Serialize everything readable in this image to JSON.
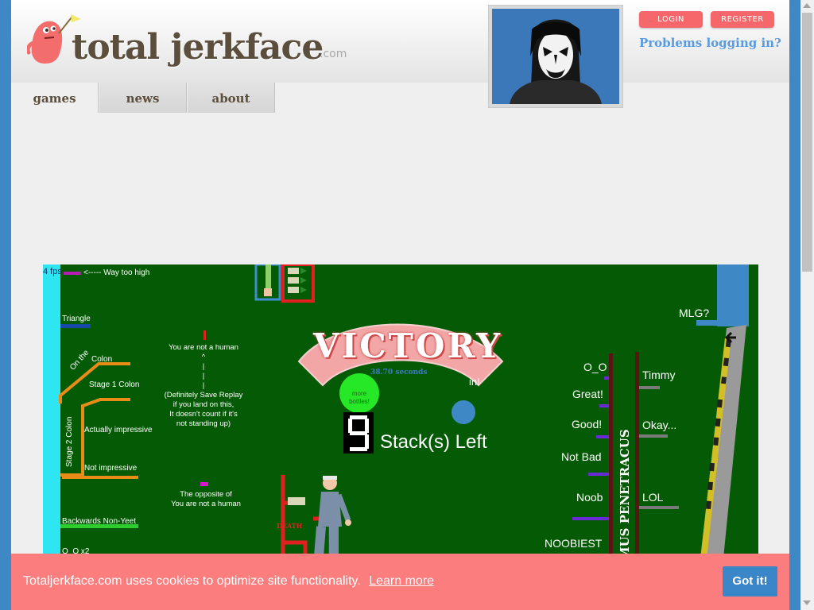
{
  "site": {
    "logo_text": "total jerkface",
    "logo_suffix": ".com"
  },
  "header": {
    "login_label": "LOGIN",
    "register_label": "REGISTER",
    "problems_link": "Problems logging in?"
  },
  "tabs": [
    {
      "label": "games",
      "active": true
    },
    {
      "label": "news",
      "active": false
    },
    {
      "label": "about",
      "active": false
    }
  ],
  "game": {
    "fps": "4 fps",
    "way_too_high": "<----- Way too high",
    "triangle": "Triangle",
    "on_the_colon_a": "On the",
    "on_the_colon_b": "Colon",
    "stage1_colon": "Stage 1 Colon",
    "stage2_colon": "Stage 2 Colon",
    "actually_impressive": "Actually impressive",
    "not_impressive": "Not impressive",
    "backwards_non_yeet": "Backwards Non-Yeet",
    "oo_x2": "O_O x2",
    "not_human_lines": [
      "You are not a human",
      "^",
      "|",
      "|",
      "|",
      "(Definitely Save Replay",
      "if you land on this,",
      "It doesn't count if it's",
      "not standing up)"
    ],
    "opposite_lines": [
      "The opposite of",
      "You are not a human"
    ],
    "victory": "VICTORY",
    "time": "38.70 seconds",
    "more_bottles": [
      "more",
      "bottles!"
    ],
    "win_partial": "in!",
    "stack_count": "9",
    "stacks_left": "Stack(s) Left",
    "death": "DEATH",
    "mlg": "MLG?",
    "right_labels_left": [
      "O_O",
      "Great!",
      "Good!",
      "Not Bad",
      "Noob",
      "NOOBIEST"
    ],
    "right_labels_right": [
      "Timmy",
      "Okay...",
      "LOL"
    ],
    "vertical_banner": "MUS PENETRACUS"
  },
  "cookie": {
    "message": "Totaljerkface.com uses cookies to optimize site functionality.",
    "learn_more": "Learn more",
    "button": "Got it!"
  },
  "colors": {
    "brand_pink": "#f5676a",
    "link_blue": "#5a9be0",
    "game_green": "#055b05",
    "cookie_bg": "#fb7d7d",
    "cookie_btn": "#3a86c8"
  }
}
